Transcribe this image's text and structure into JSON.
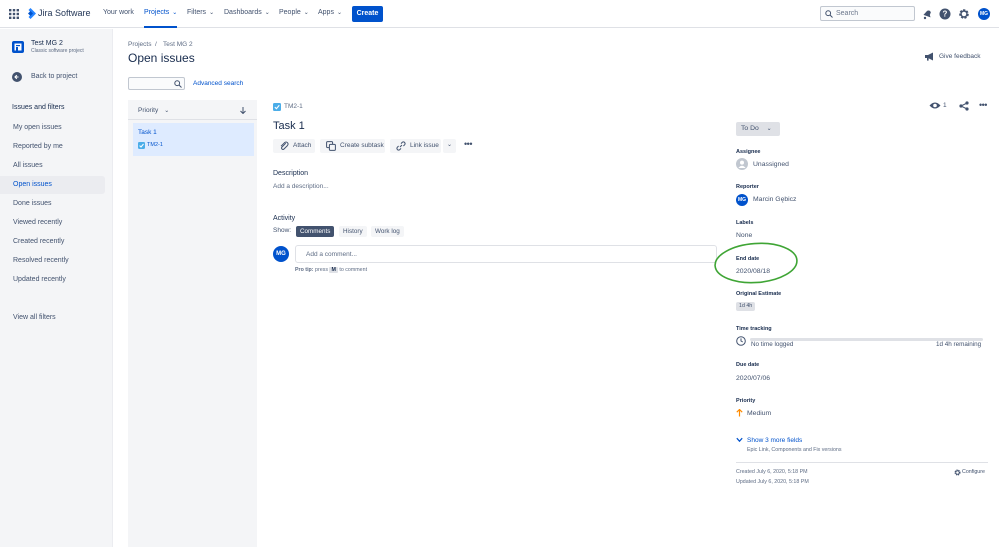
{
  "nav": {
    "brand": "Jira Software",
    "items": [
      {
        "label": "Your work",
        "chevron": false
      },
      {
        "label": "Projects",
        "chevron": true
      },
      {
        "label": "Filters",
        "chevron": true
      },
      {
        "label": "Dashboards",
        "chevron": true
      },
      {
        "label": "People",
        "chevron": true
      },
      {
        "label": "Apps",
        "chevron": true
      }
    ],
    "create_label": "Create",
    "search_placeholder": "Search",
    "user_initials": "MG"
  },
  "sidebar": {
    "project_name": "Test MG 2",
    "project_type": "Classic software project",
    "back_label": "Back to project",
    "section_title": "Issues and filters",
    "items": [
      "My open issues",
      "Reported by me",
      "All issues",
      "Open issues",
      "Done issues",
      "Viewed recently",
      "Created recently",
      "Resolved recently",
      "Updated recently"
    ],
    "view_all": "View all filters"
  },
  "page": {
    "breadcrumb_projects": "Projects",
    "breadcrumb_sep": "/",
    "breadcrumb_project": "Test MG 2",
    "title": "Open issues",
    "advanced_search": "Advanced search",
    "give_feedback": "Give feedback"
  },
  "list": {
    "sort_label": "Priority",
    "issue_title": "Task 1",
    "issue_key": "TM2-1"
  },
  "issue": {
    "key": "TM2-1",
    "title": "Task 1",
    "attach": "Attach",
    "create_subtask": "Create subtask",
    "link_issue": "Link issue",
    "description_label": "Description",
    "description_placeholder": "Add a description...",
    "activity_label": "Activity",
    "show_label": "Show:",
    "tabs": [
      "Comments",
      "History",
      "Work log"
    ],
    "comment_placeholder": "Add a comment...",
    "protip_bold": "Pro tip:",
    "protip_press": "press",
    "protip_key": "M",
    "protip_rest": "to comment",
    "watchers": "1"
  },
  "details": {
    "status": "To Do",
    "assignee_label": "Assignee",
    "assignee": "Unassigned",
    "reporter_label": "Reporter",
    "reporter": "Marcin Gębicz",
    "labels_label": "Labels",
    "labels": "None",
    "end_date_label": "End date",
    "end_date": "2020/08/18",
    "original_estimate_label": "Original Estimate",
    "original_estimate": "1d 4h",
    "time_tracking_label": "Time tracking",
    "time_logged": "No time logged",
    "time_remaining": "1d 4h remaining",
    "due_date_label": "Due date",
    "due_date": "2020/07/06",
    "priority_label": "Priority",
    "priority": "Medium",
    "more_fields": "Show 3 more fields",
    "more_fields_sub": "Epic Link, Components and Fix versions",
    "created": "Created July 6, 2020, 5:18 PM",
    "updated": "Updated July 6, 2020, 5:18 PM",
    "configure": "Configure"
  },
  "colors": {
    "accent": "#0052cc",
    "highlight_circle": "#3fa535",
    "priority_medium": "#ff8b00"
  }
}
